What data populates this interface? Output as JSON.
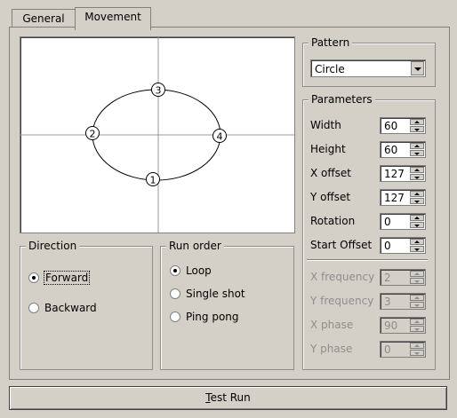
{
  "tabs": [
    {
      "label": "General",
      "active": false
    },
    {
      "label": "Movement",
      "active": true
    }
  ],
  "preview": {
    "points": [
      "1",
      "2",
      "3",
      "4"
    ]
  },
  "direction": {
    "title": "Direction",
    "options": [
      {
        "label": "Forward",
        "checked": true
      },
      {
        "label": "Backward",
        "checked": false
      }
    ]
  },
  "run_order": {
    "title": "Run order",
    "options": [
      {
        "label": "Loop",
        "checked": true
      },
      {
        "label": "Single shot",
        "checked": false
      },
      {
        "label": "Ping pong",
        "checked": false
      }
    ]
  },
  "pattern": {
    "title": "Pattern",
    "selected": "Circle"
  },
  "parameters": {
    "title": "Parameters",
    "fields": [
      {
        "label": "Width",
        "value": "60",
        "enabled": true
      },
      {
        "label": "Height",
        "value": "60",
        "enabled": true
      },
      {
        "label": "X offset",
        "value": "127",
        "enabled": true
      },
      {
        "label": "Y offset",
        "value": "127",
        "enabled": true
      },
      {
        "label": "Rotation",
        "value": "0",
        "enabled": true
      },
      {
        "label": "Start Offset",
        "value": "0",
        "enabled": true
      },
      {
        "label": "X frequency",
        "value": "2",
        "enabled": false
      },
      {
        "label": "Y frequency",
        "value": "3",
        "enabled": false
      },
      {
        "label": "X phase",
        "value": "90",
        "enabled": false
      },
      {
        "label": "Y phase",
        "value": "0",
        "enabled": false
      }
    ]
  },
  "test_run_label": "Test Run",
  "colors": {
    "background": "#d4d0c8",
    "disabled_text": "#8e8e8e"
  }
}
